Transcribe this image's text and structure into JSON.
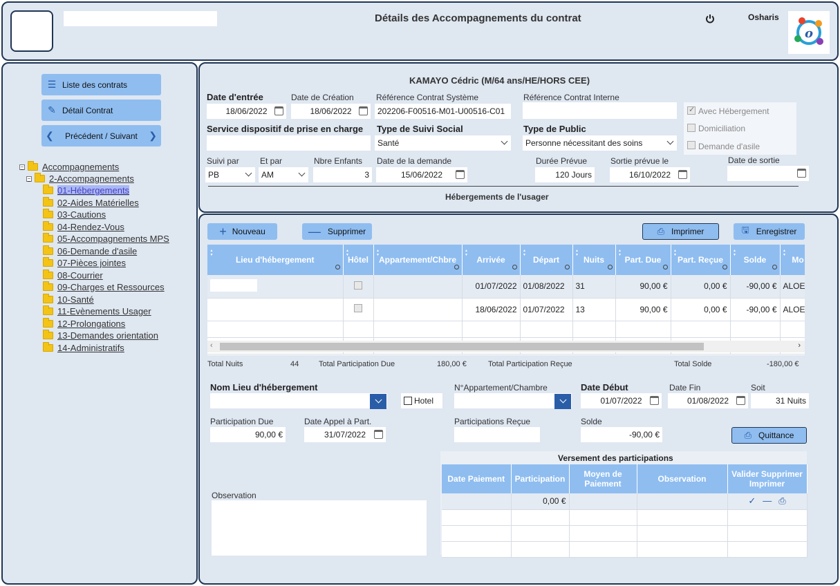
{
  "header": {
    "title": "Détails des Accompagnements du contrat",
    "user": "Osharis",
    "search_value": ""
  },
  "nav": {
    "list_label": "Liste des contrats",
    "detail_label": "Détail Contrat",
    "prevnext_label": "Précédent / Suivant"
  },
  "tree": {
    "root": "Accompagnements",
    "sub": "2-Accompagnements",
    "items": [
      "01-Hébergements",
      "02-Aides Matérielles",
      "03-Cautions",
      "04-Rendez-Vous",
      "05-Accompagnements MPS",
      "06-Demande d'asile",
      "07-Pièces jointes",
      "08-Courrier",
      "09-Charges et Ressources",
      "10-Santé",
      "11-Evènements Usager",
      "12-Prolongations",
      "13-Demandes orientation",
      "14-Administratifs"
    ]
  },
  "contract": {
    "person": "KAMAYO Cédric (M/64 ans/HE/HORS CEE)",
    "date_entree_label": "Date d'entrée",
    "date_entree": "18/06/2022",
    "date_creation_label": "Date de Création",
    "date_creation": "18/06/2022",
    "ref_sys_label": "Référence Contrat Système",
    "ref_sys": "202206-F00516-M01-U00516-C01",
    "ref_int_label": "Référence Contrat Interne",
    "ref_int": "",
    "avec_heb": "Avec Hébergement",
    "domiciliation": "Domiciliation",
    "demande_asile": "Demande d'asile",
    "service_label": "Service dispositif de prise en charge",
    "service": "",
    "suivi_social_label": "Type de Suivi Social",
    "suivi_social": "Santé",
    "public_label": "Type de Public",
    "public": "Personne nécessitant des soins",
    "suivi_par_label": "Suivi par",
    "suivi_par": "PB",
    "et_par_label": "Et par",
    "et_par": "AM",
    "enfants_label": "Nbre Enfants",
    "enfants": "3",
    "date_demande_label": "Date de la demande",
    "date_demande": "15/06/2022",
    "duree_label": "Durée Prévue",
    "duree": "120 Jours",
    "sortie_prevue_label": "Sortie prévue le",
    "sortie_prevue": "16/10/2022",
    "date_sortie_label": "Date de sortie",
    "date_sortie": "",
    "section_title": "Hébergements de l'usager"
  },
  "toolbar": {
    "nouveau": "Nouveau",
    "supprimer": "Supprimer",
    "imprimer": "Imprimer",
    "enregistrer": "Enregistrer"
  },
  "grid": {
    "columns": [
      "Lieu d'hébergement",
      "Hôtel",
      "Appartement/Chbre",
      "Arrivée",
      "Départ",
      "Nuits",
      "Part. Due",
      "Part. Reçue",
      "Solde",
      "Mo"
    ],
    "rows": [
      [
        "",
        "",
        "",
        "01/07/2022",
        "01/08/2022",
        "31",
        "90,00 €",
        "0,00 €",
        "-90,00 €",
        "ALOE"
      ],
      [
        "",
        "",
        "",
        "18/06/2022",
        "01/07/2022",
        "13",
        "90,00 €",
        "0,00 €",
        "-90,00 €",
        "ALOE"
      ]
    ]
  },
  "totals": {
    "nuits_label": "Total Nuits",
    "nuits": "44",
    "due_label": "Total Participation Due",
    "due": "180,00 €",
    "recue_label": "Total Participation Reçue",
    "recue": "",
    "solde_label": "Total Solde",
    "solde": "-180,00 €"
  },
  "form": {
    "lieu_label": "Nom Lieu d'hébergement",
    "lieu": "",
    "hotel_label": "Hotel",
    "appart_label": "N°Appartement/Chambre",
    "appart": "",
    "date_debut_label": "Date Début",
    "date_debut": "01/07/2022",
    "date_fin_label": "Date Fin",
    "date_fin": "01/08/2022",
    "soit_label": "Soit",
    "soit": "31 Nuits",
    "part_due_label": "Participation Due",
    "part_due": "90,00 €",
    "appel_label": "Date Appel à Part.",
    "appel": "31/07/2022",
    "part_recue_label": "Participations Reçue",
    "part_recue": "",
    "solde_label": "Solde",
    "solde": "-90,00 €",
    "quittance": "Quittance",
    "observation_label": "Observation",
    "observation": ""
  },
  "versements": {
    "title": "Versement des participations",
    "columns": [
      "Date Paiement",
      "Participation",
      "Moyen de Paiement",
      "Observation",
      "Valider Supprimer Imprimer"
    ],
    "rows": [
      [
        "",
        "0,00 €",
        "",
        ""
      ]
    ]
  }
}
